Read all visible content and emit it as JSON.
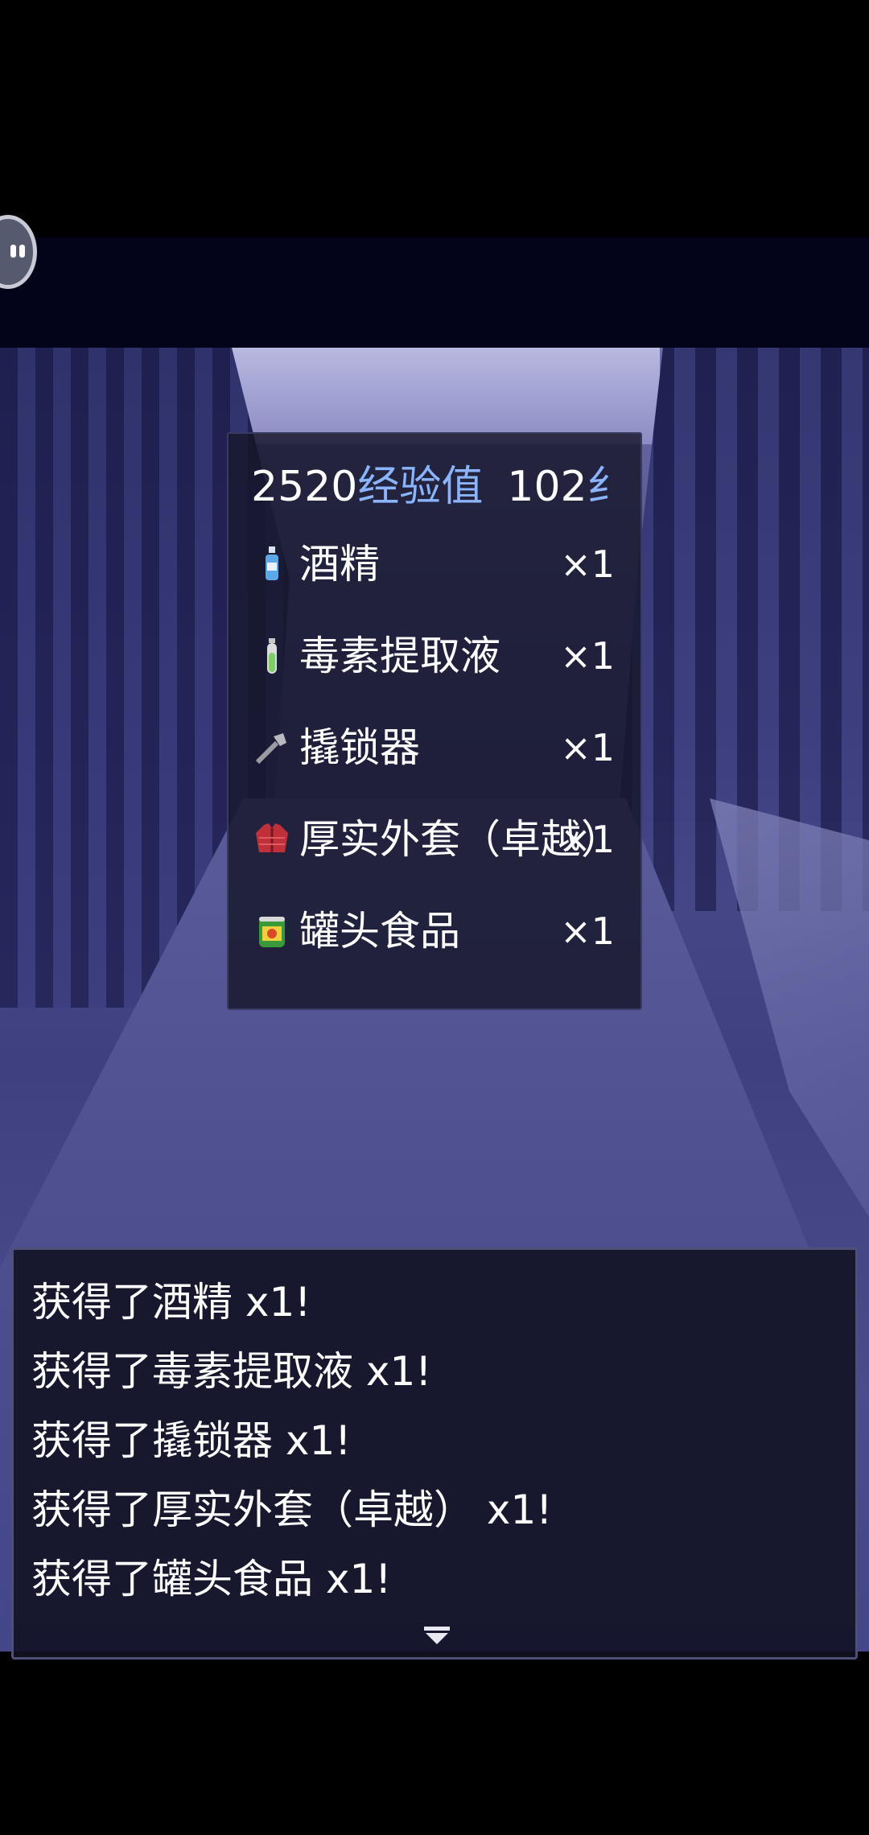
{
  "reward_window": {
    "exp_value": "2520",
    "exp_unit": "经验值",
    "second_value": "102",
    "second_unit_partial": "纟",
    "items": [
      {
        "name": "酒精",
        "qty": "×1",
        "icon": "alcohol-bottle-icon"
      },
      {
        "name": "毒素提取液",
        "qty": "×1",
        "icon": "toxin-vial-icon"
      },
      {
        "name": "撬锁器",
        "qty": "×1",
        "icon": "lockpick-icon"
      },
      {
        "name": "厚实外套（卓越）",
        "qty": "×1",
        "icon": "jacket-icon"
      },
      {
        "name": "罐头食品",
        "qty": "×1",
        "icon": "canned-food-icon"
      }
    ]
  },
  "message_box": {
    "lines": [
      "获得了酒精 x1!",
      "获得了毒素提取液 x1!",
      "获得了撬锁器 x1!",
      "获得了厚实外套（卓越） x1!",
      "获得了罐头食品 x1!"
    ],
    "continue_icon": "continue-arrow-icon"
  },
  "overlay": {
    "float_button_icon": "assistant-bubble-icon"
  },
  "colors": {
    "exp_unit": "#8bb4ff",
    "window_bg": "#16162a",
    "text": "#ffffff"
  }
}
